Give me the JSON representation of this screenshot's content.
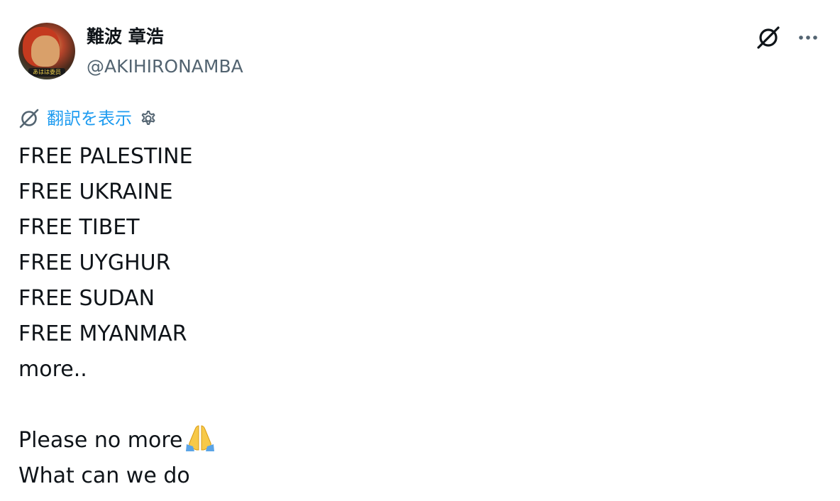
{
  "author": {
    "display_name": "難波 章浩",
    "handle": "@AKIHIRONAMBA",
    "avatar_caption": "あはは委员"
  },
  "header_actions": {
    "grok_icon": "grok-icon",
    "more_icon": "more-icon"
  },
  "translate": {
    "label": "翻訳を表示",
    "icon": "grok-translate-icon",
    "settings_icon": "gear-icon"
  },
  "tweet": {
    "lines": [
      "FREE PALESTINE",
      "FREE UKRAINE",
      "FREE TIBET",
      "FREE UYGHUR",
      "FREE SUDAN",
      "FREE MYANMAR",
      "more..",
      "",
      "Please no more",
      "What can we do"
    ],
    "emoji": "folded-hands-emoji"
  },
  "colors": {
    "text": "#0f1419",
    "secondary": "#536471",
    "link": "#1d9bf0"
  }
}
